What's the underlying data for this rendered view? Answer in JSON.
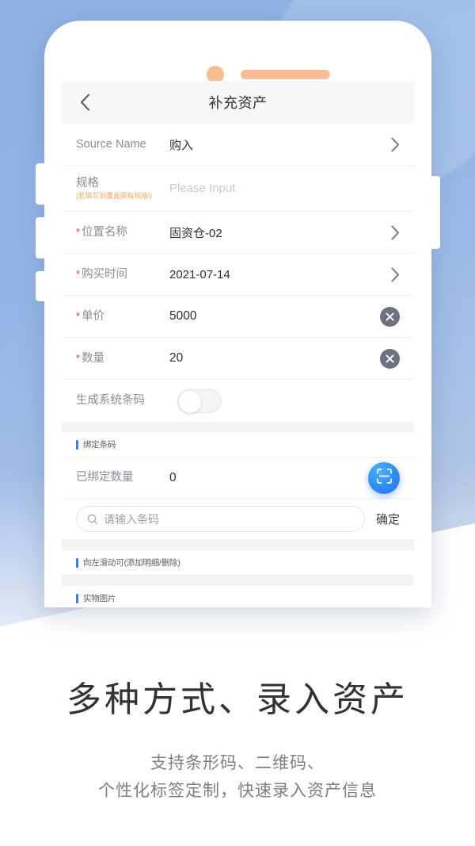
{
  "background": {
    "blue_top": "#8eb1e3",
    "blue_bottom": "#c3cfe2"
  },
  "phone": {
    "camera_dot": "camera-dot",
    "speaker": "speaker-grill"
  },
  "navbar": {
    "back_icon": "chevron-left-icon",
    "title": "补充资产"
  },
  "form": {
    "rows": [
      {
        "label": "Source Name",
        "required": false,
        "sub": "",
        "value": "购入",
        "placeholder": "",
        "accessory": "chevron"
      },
      {
        "label": "规格",
        "required": false,
        "sub": "(若填写到覆盖原有规格!)",
        "value": "",
        "placeholder": "Please Input",
        "accessory": "none"
      },
      {
        "label": "位置名称",
        "required": true,
        "sub": "",
        "value": "固资仓-02",
        "placeholder": "",
        "accessory": "chevron"
      },
      {
        "label": "购买时间",
        "required": true,
        "sub": "",
        "value": "2021-07-14",
        "placeholder": "",
        "accessory": "chevron"
      },
      {
        "label": "单价",
        "required": true,
        "sub": "",
        "value": "5000",
        "placeholder": "",
        "accessory": "clear"
      },
      {
        "label": "数量",
        "required": true,
        "sub": "",
        "value": "20",
        "placeholder": "",
        "accessory": "clear"
      },
      {
        "label": "生成系统条码",
        "required": false,
        "sub": "",
        "value": "",
        "placeholder": "",
        "accessory": "switch"
      }
    ],
    "required_star": "*",
    "switch_state": "off"
  },
  "barcode_section": {
    "header": "绑定条码",
    "bound_count_label": "已绑定数量",
    "bound_count_value": "0",
    "scan_icon": "barcode-scan-icon",
    "search_placeholder": "请输入条码",
    "search_value": "",
    "search_icon": "search-icon",
    "confirm_label": "确定"
  },
  "swipe_section": {
    "header": "向左滑动可(添加明细/删除)"
  },
  "photo_section": {
    "header": "实物图片"
  },
  "marketing": {
    "headline": "多种方式、录入资产",
    "sub_line_1": "支持条形码、二维码、",
    "sub_line_2": "个性化标签定制，快速录入资产信息"
  },
  "colors": {
    "accent_blue": "#3b7bf0",
    "required_red": "#f5333f",
    "warning_orange": "#f0a963",
    "scan_blue": "#2e8cf5"
  }
}
